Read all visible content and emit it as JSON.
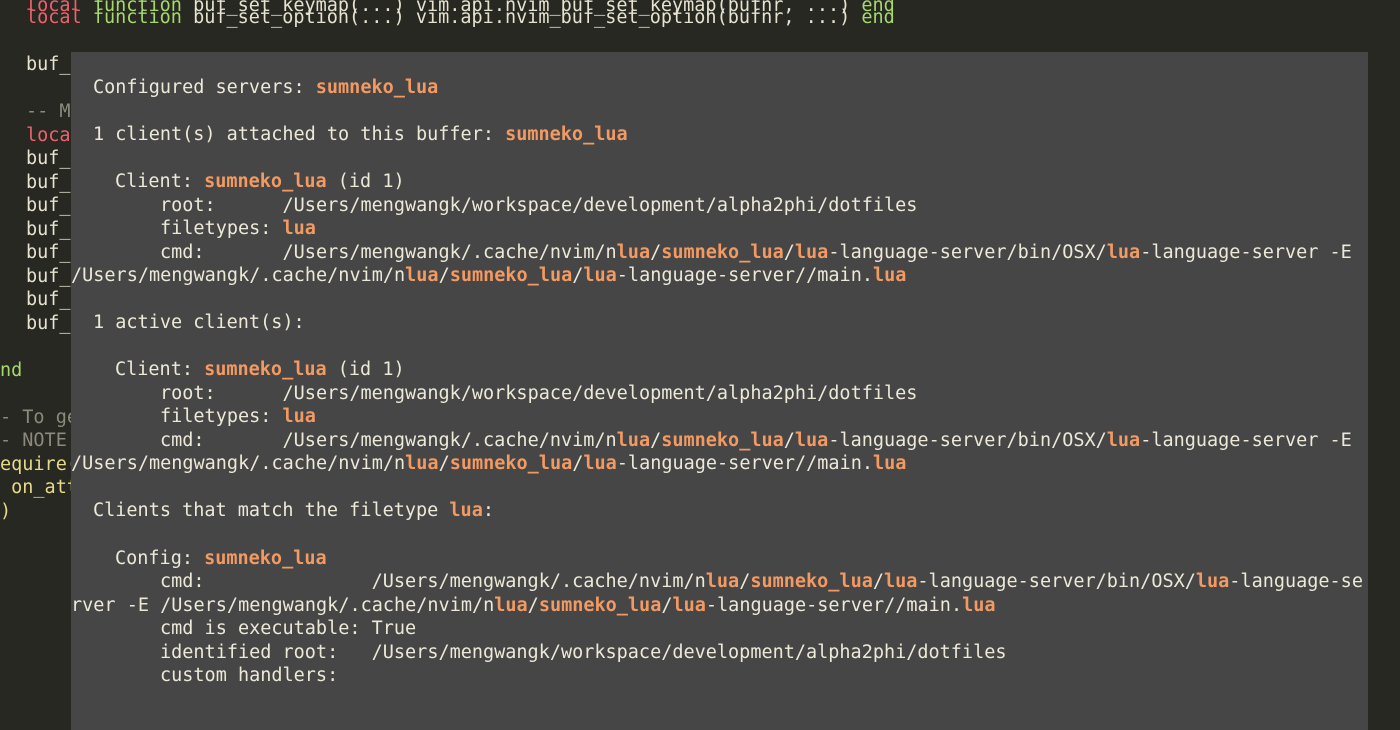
{
  "editor": {
    "line1": {
      "kw": "local",
      "fn": "function",
      "text": " buf_set_option(...) vim.api.nvim_buf_set_option(bufnr, ...) ",
      "end": "end"
    },
    "line2_text": "buf_",
    "line3_text": "-- M",
    "line4_kw": "loca",
    "buf_prefix": "buf_",
    "end_frag": "nd",
    "comment1": "- To ge",
    "comment2": "- NOTE:",
    "require_frag": "equire(",
    "on_att_frag": " on_att",
    "paren_frag": ")"
  },
  "lsp_info": {
    "configured_label": "Configured servers: ",
    "server_name": "sumneko_lua",
    "attached_label": "1 client(s) attached to this buffer: ",
    "client_label": "Client: ",
    "client_id": " (id 1)",
    "root_label": "root:      ",
    "root_path": "/Users/mengwangk/workspace/development/alpha2phi/dotfiles",
    "filetypes_label": "filetypes: ",
    "filetype": "lua",
    "cmd_label": "cmd:       ",
    "cmd_path_a": "/Users/mengwangk/.cache/nvim/n",
    "sep": "/",
    "server_bin_mid": "-language-server/bin/OSX/",
    "server_flag": "-language-server -E",
    "cmd_path_b": "/Users/mengwangk/.cache/nvim/n",
    "server_main": "-language-server//main.",
    "active_label": "1 active client(s):",
    "match_label": "Clients that match the filetype ",
    "match_colon": ":",
    "config_label": "Config: ",
    "cmd2_label": "cmd:               ",
    "cmd2_tail": "-language-se",
    "cmd2_wrap": "rver -E ",
    "executable_label": "cmd is executable: ",
    "executable_value": "True",
    "identified_label": "identified root:   ",
    "handlers_label": "custom handlers:"
  }
}
